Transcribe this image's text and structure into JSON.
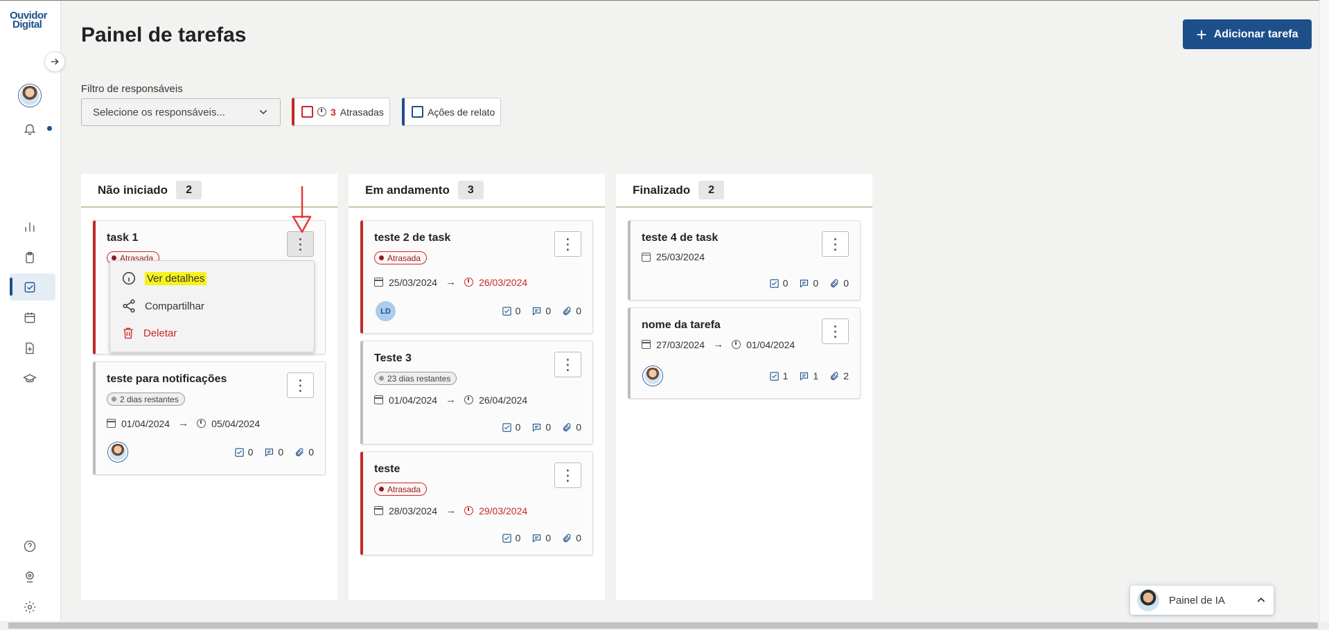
{
  "logo": {
    "line1": "Ouvidor",
    "line2": "Digital"
  },
  "header": {
    "title": "Painel de tarefas",
    "add_label": "Adicionar tarefa"
  },
  "filters": {
    "label": "Filtro de responsáveis",
    "select_placeholder": "Selecione os responsáveis...",
    "late_chip": {
      "count": "3",
      "label": "Atrasadas"
    },
    "acoes_chip": {
      "label": "Ações de relato"
    }
  },
  "columns": [
    {
      "title": "Não iniciado",
      "count": "2"
    },
    {
      "title": "Em andamento",
      "count": "3"
    },
    {
      "title": "Finalizado",
      "count": "2"
    }
  ],
  "cards": {
    "c1": {
      "title": "task 1",
      "badge": "Atrasada"
    },
    "c2": {
      "title": "teste para notificações",
      "badge": "2 dias restantes",
      "start": "01/04/2024",
      "end": "05/04/2024",
      "checks": "0",
      "comments": "0",
      "attachments": "0"
    },
    "c3": {
      "title": "teste 2 de task",
      "badge": "Atrasada",
      "start": "25/03/2024",
      "end": "26/03/2024",
      "initials": "LD",
      "checks": "0",
      "comments": "0",
      "attachments": "0"
    },
    "c4": {
      "title": "Teste 3",
      "badge": "23 dias restantes",
      "start": "01/04/2024",
      "end": "26/04/2024",
      "checks": "0",
      "comments": "0",
      "attachments": "0"
    },
    "c5": {
      "title": "teste",
      "badge": "Atrasada",
      "start": "28/03/2024",
      "end": "29/03/2024",
      "checks": "0",
      "comments": "0",
      "attachments": "0"
    },
    "c6": {
      "title": "teste 4 de task",
      "start": "25/03/2024",
      "checks": "0",
      "comments": "0",
      "attachments": "0"
    },
    "c7": {
      "title": "nome da tarefa",
      "start": "27/03/2024",
      "end": "01/04/2024",
      "checks": "1",
      "comments": "1",
      "attachments": "2"
    }
  },
  "menu": {
    "details": "Ver detalhes",
    "share": "Compartilhar",
    "delete": "Deletar"
  },
  "ai_panel": {
    "label": "Painel de IA"
  },
  "colors": {
    "brand": "#1d4f8a",
    "danger": "#c62828",
    "highlight": "#f7f21a"
  }
}
